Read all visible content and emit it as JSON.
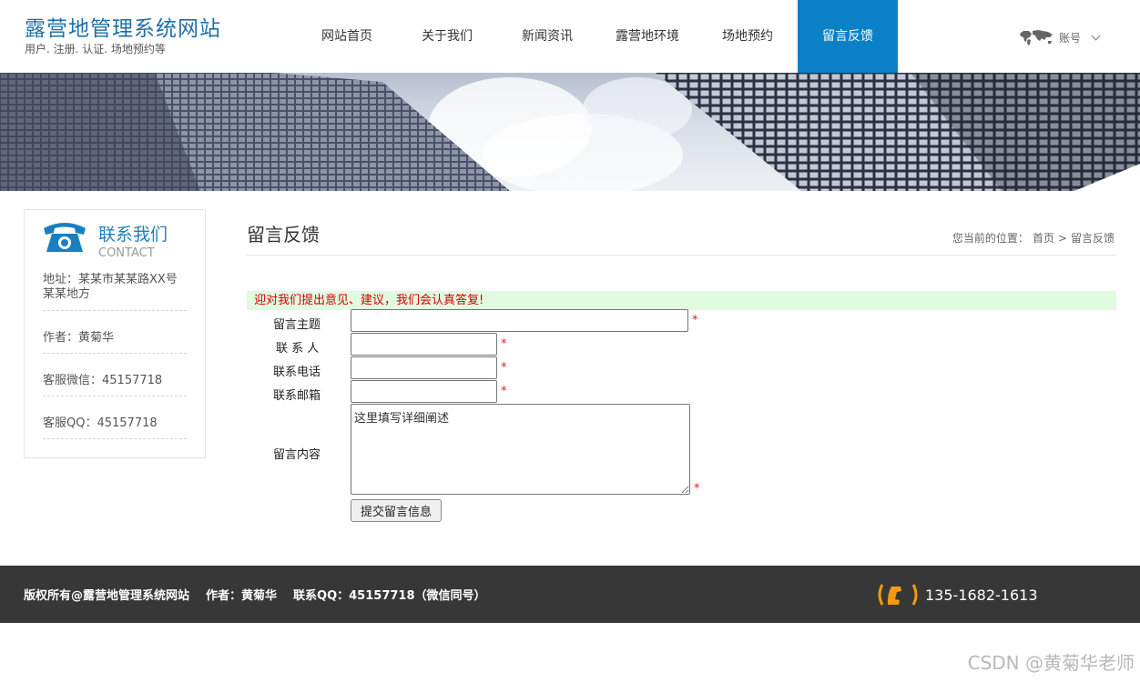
{
  "header": {
    "site_title": "露营地管理系统网站",
    "site_subtitle": "用户. 注册. 认证. 场地预约等",
    "nav": [
      {
        "label": "网站首页",
        "active": false
      },
      {
        "label": "关于我们",
        "active": false
      },
      {
        "label": "新闻资讯",
        "active": false
      },
      {
        "label": "露营地环境",
        "active": false
      },
      {
        "label": "场地预约",
        "active": false
      },
      {
        "label": "留言反馈",
        "active": true
      }
    ],
    "account_label": "账号"
  },
  "sidebar": {
    "title": "联系我们",
    "title_en": "CONTACT",
    "items": [
      {
        "text": "地址：某某市某某路XX号某某地方"
      },
      {
        "text": "作者：黄菊华"
      },
      {
        "text": "客服微信：45157718"
      },
      {
        "text": "客服QQ：45157718"
      }
    ]
  },
  "main": {
    "title": "留言反馈",
    "breadcrumb": {
      "prefix": "您当前的位置：",
      "home": "首页",
      "separator": ">",
      "current": "留言反馈"
    },
    "notice": "迎对我们提出意见、建议，我们会认真答复!",
    "form": {
      "subject_label": "留言主题",
      "contact_label": "联 系 人",
      "phone_label": "联系电话",
      "email_label": "联系邮箱",
      "content_label": "留言内容",
      "content_value": "这里填写详细阐述",
      "required_mark": "*",
      "submit_label": "提交留言信息"
    }
  },
  "footer": {
    "copyright": "版权所有@露营地管理系统网站",
    "author": "作者：黄菊华",
    "qq": "联系QQ：45157718（微信同号）",
    "phone": "135-1682-1613"
  },
  "watermark": "CSDN @黄菊华老师",
  "colors": {
    "brand": "#1e6fa8",
    "nav_active": "#0a81c6",
    "footer_bg": "#373737",
    "notice_bg": "#e0fbe0",
    "notice_text": "#d40000",
    "phone_accent": "#f39a12"
  },
  "icons": {
    "account": "world-map-icon",
    "contact": "telephone-icon",
    "footer_phone": "phone-handset-icon"
  }
}
